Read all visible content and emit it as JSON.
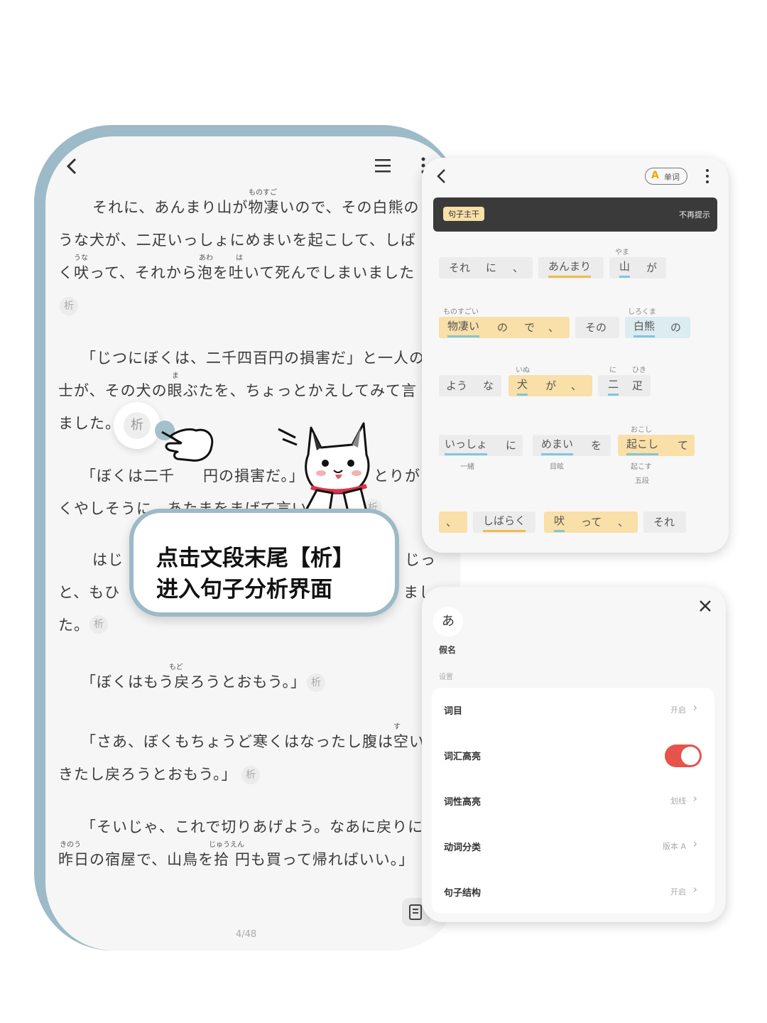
{
  "reader": {
    "para1": {
      "ruby1": "ものすご",
      "line1": "それに、あんまり山が物凄いので、その白熊の",
      "line2": "うな犬が、二疋いっしょにめまいを起こして、しば",
      "ruby2a": "うな",
      "ruby2b": "あわ",
      "ruby2c": "は",
      "line3": "く吠って、それから泡を吐いて死んでしまいました"
    },
    "para2": {
      "line1": "「じつにぼくは、二千四百円の損害だ」と一人の",
      "ruby1": "ま",
      "line2": "士が、その犬の眼ぶたを、ちょっとかえしてみて言",
      "line3": "ました。"
    },
    "para3": {
      "line1a": "「ぼくは二千",
      "line1b": "円の損害だ。」と",
      "line1c": "とりが",
      "line2": "くやしそうに、あたまをまげて言い"
    },
    "para4": {
      "line1a": "はじ",
      "line1b": "じっ",
      "line2a": "と、もひ",
      "line2b": "まし",
      "line3": "た。"
    },
    "para5": {
      "ruby1": "もど",
      "line1": "「ぼくはもう戻ろうとおもう。」"
    },
    "para6": {
      "ruby1": "す",
      "line1": "「さあ、ぼくもちょうど寒くはなったし腹は空い",
      "line2": "きたし戻ろうとおもう。」"
    },
    "para7": {
      "line1": "「そいじゃ、これで切りあげよう。なあに戻りに",
      "ruby1": "きのう",
      "ruby2": "じゅうえん",
      "line2": "昨日の宿屋で、山鳥を拾 円も買って帰ればいい。」"
    },
    "analyze_label": "析",
    "page": "4/48"
  },
  "callout": {
    "line1": "点击文段末尾【析】",
    "line2": "进入句子分析界面"
  },
  "analysis": {
    "word_button": "单词",
    "banner_tag": "句子主干",
    "banner_dismiss": "不再提示",
    "rows": {
      "r1": {
        "t1": "それ",
        "t2": "に",
        "t3": "、",
        "t4": "あんまり",
        "ruby": "やま",
        "t5": "山",
        "t6": "が"
      },
      "r2": {
        "ruby1": "ものすごい",
        "t1": "物凄い",
        "t2": "の",
        "t3": "で",
        "t4": "、",
        "t5": "その",
        "ruby2": "しろくま",
        "t6": "白熊",
        "t7": "の"
      },
      "r3": {
        "t1": "よう",
        "t2": "な",
        "ruby1": "いぬ",
        "t3": "犬",
        "t4": "が",
        "t5": "、",
        "ruby2": "に",
        "ruby3": "ひき",
        "t6": "二",
        "t7": "疋"
      },
      "r4": {
        "t1": "いっしょ",
        "t2": "に",
        "sub1": "一緒",
        "t3": "めまい",
        "t4": "を",
        "sub2": "目眩",
        "ruby": "おこし",
        "t5": "起こし",
        "t6": "て",
        "sub3": "起こす",
        "sub4": "五段"
      },
      "r5": {
        "t1": "、",
        "t2": "しばらく",
        "t3": "吠",
        "t4": "って",
        "t5": "、",
        "t6": "それ"
      }
    }
  },
  "settings": {
    "kana_char": "あ",
    "kana_label": "假名",
    "section": "设置",
    "rows": [
      {
        "label": "词目",
        "value": "开启"
      },
      {
        "label": "词汇高亮",
        "value": ""
      },
      {
        "label": "词性高亮",
        "value": "划线"
      },
      {
        "label": "动词分类",
        "value": "版本 A"
      },
      {
        "label": "句子结构",
        "value": "开启"
      }
    ],
    "vocab_toggle_on": true
  },
  "colors": {
    "frame": "#9cbac8",
    "yellow_chip": "#f9dfa8",
    "blue_chip": "#dcecf1",
    "toggle": "#e6534b"
  }
}
